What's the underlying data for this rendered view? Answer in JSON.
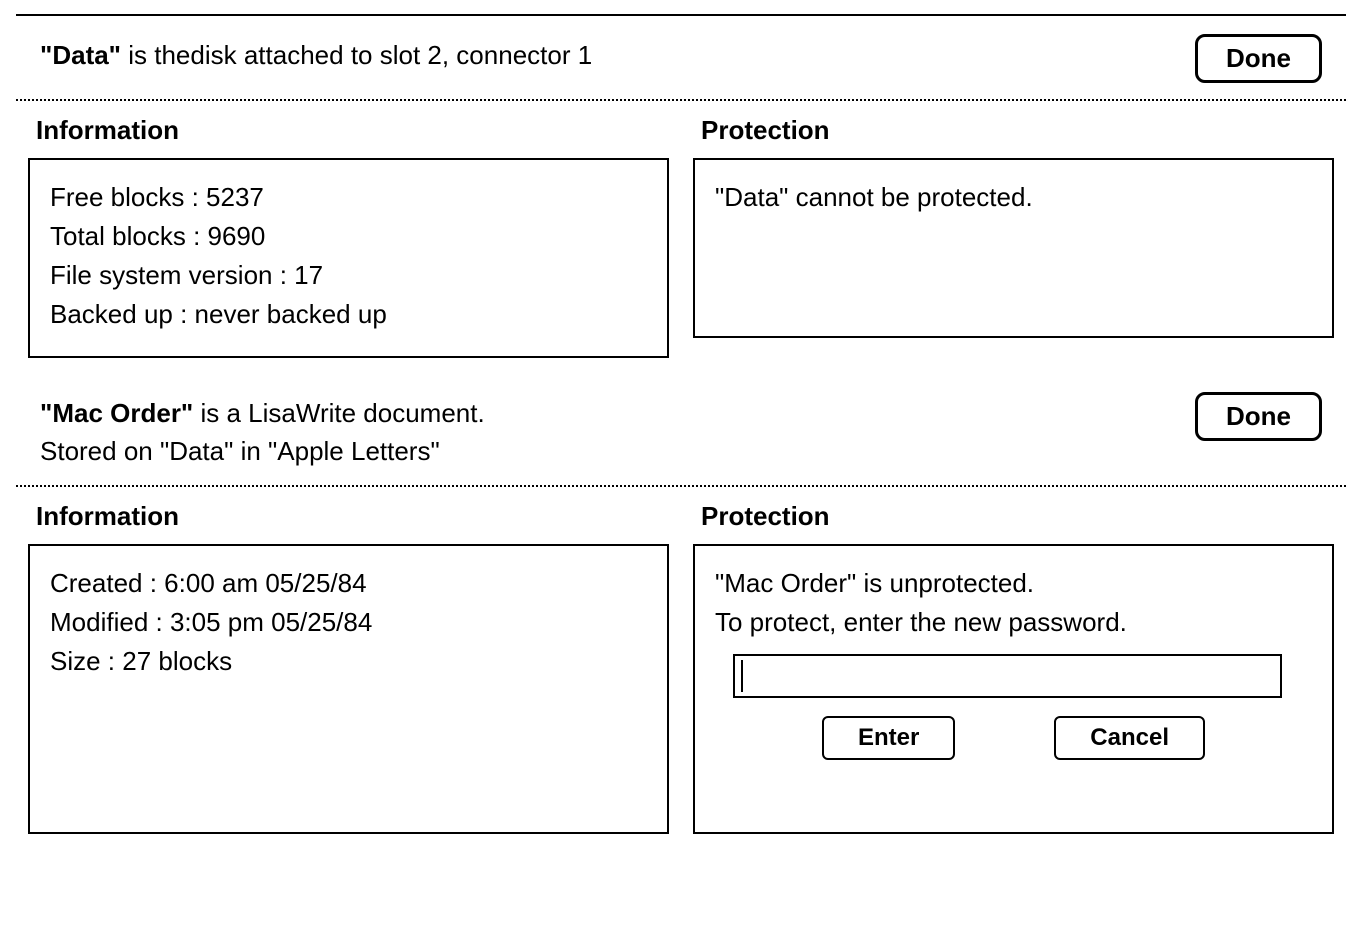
{
  "disk_panel": {
    "title_name": "\"Data\"",
    "title_rest": " is thedisk attached to slot 2, connector 1",
    "done_label": "Done",
    "information_title": "Information",
    "protection_title": "Protection",
    "info": {
      "free_blocks": "Free blocks : 5237",
      "total_blocks": "Total blocks : 9690",
      "fs_version": "File system version : 17",
      "backed_up": "Backed up : never backed up"
    },
    "protection_message": "\"Data\" cannot be protected."
  },
  "doc_panel": {
    "title_name": "\"Mac Order\"",
    "title_rest": " is a LisaWrite document.",
    "stored_on": "Stored on \"Data\" in \"Apple Letters\"",
    "done_label": "Done",
    "information_title": "Information",
    "protection_title": "Protection",
    "info": {
      "created": "Created :  6:00 am 05/25/84",
      "modified": "Modified :  3:05 pm 05/25/84",
      "size": "Size : 27 blocks"
    },
    "protection": {
      "status": "\"Mac Order\" is unprotected.",
      "instruction": "To protect, enter the new password.",
      "password_value": "",
      "enter_label": "Enter",
      "cancel_label": "Cancel"
    }
  }
}
